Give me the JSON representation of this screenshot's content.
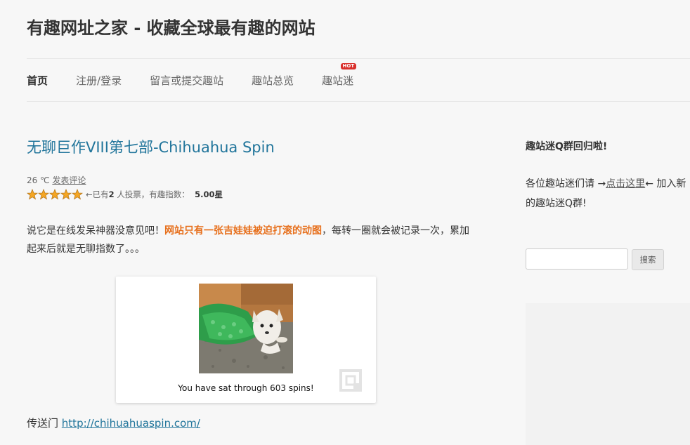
{
  "site": {
    "title": "有趣网址之家 - 收藏全球最有趣的网站"
  },
  "nav": {
    "items": [
      {
        "label": "首页"
      },
      {
        "label": "注册/登录"
      },
      {
        "label": "留言或提交趣站"
      },
      {
        "label": "趣站总览"
      },
      {
        "label": "趣站迷",
        "badge": "HOT"
      }
    ]
  },
  "post": {
    "title": "无聊巨作VIII第七部-Chihuahua Spin",
    "temperature": "26 ℃",
    "comment_link": "发表评论",
    "rating": {
      "stars_filled": 5,
      "stars_total": 5,
      "prefix": "←已有",
      "votes": "2",
      "suffix": "人投票，有趣指数：",
      "score": "5.00",
      "unit": "星"
    },
    "body_before": "说它是在线发呆神器没意见吧！",
    "body_highlight": "网站只有一张吉娃娃被迫打滚的动图",
    "body_after": "，每转一圈就会被记录一次，累加起来后就是无聊指数了。。。",
    "embed": {
      "caption": "You have sat through 603 spins!"
    },
    "portal_label": "传送门",
    "portal_url": "http://chihuahuaspin.com/"
  },
  "sidebar": {
    "widget_title": "趣站迷Q群回归啦!",
    "text_before": "各位趣站迷们请 →",
    "text_link": "点击这里",
    "text_after": "← 加入新的趣站迷Q群!",
    "search_placeholder": "",
    "search_button": "搜索"
  },
  "colors": {
    "link": "#21759b",
    "highlight": "#e76f1b",
    "hot_badge": "#d9302c",
    "star": "#f5a623"
  }
}
